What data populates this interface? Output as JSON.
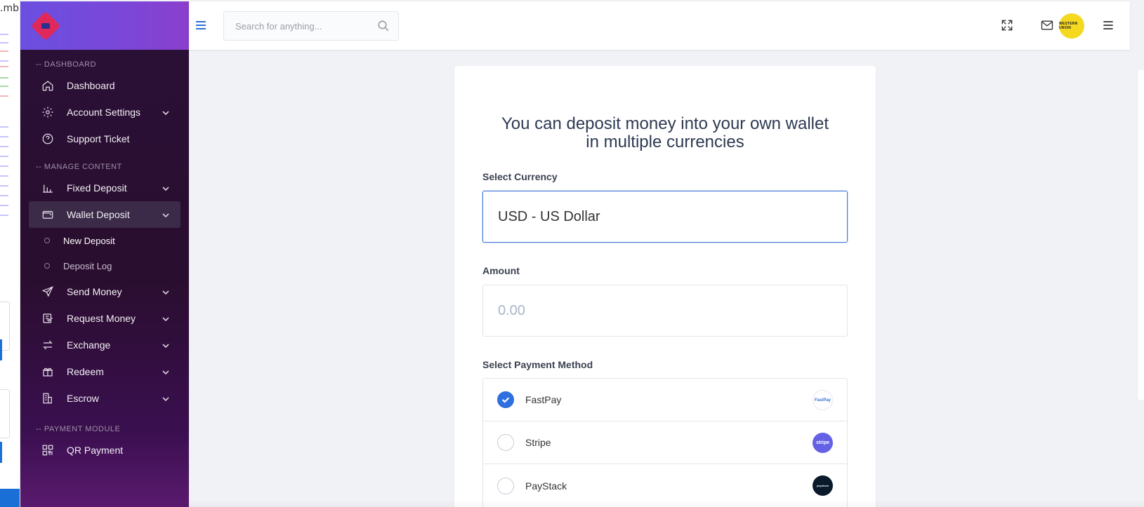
{
  "window": {
    "partial_title": ".mb"
  },
  "colors": {
    "accent": "#2f6fe0",
    "sidebar_bg": "#2b1038",
    "brand_bar": "#6b4fe0",
    "logo": "#e0285a",
    "avatar": "#f5d820"
  },
  "sidebar": {
    "sections": [
      {
        "label": "-- DASHBOARD"
      },
      {
        "label": "-- MANAGE CONTENT"
      },
      {
        "label": "-- PAYMENT MODULE"
      }
    ],
    "items": {
      "dashboard": {
        "label": "Dashboard",
        "icon": "home-icon"
      },
      "account_settings": {
        "label": "Account Settings",
        "icon": "gear-icon"
      },
      "support_ticket": {
        "label": "Support Ticket",
        "icon": "help-circle-icon"
      },
      "fixed_deposit": {
        "label": "Fixed Deposit",
        "icon": "bar-chart-icon"
      },
      "wallet_deposit": {
        "label": "Wallet Deposit",
        "icon": "wallet-icon"
      },
      "new_deposit": {
        "label": "New Deposit"
      },
      "deposit_log": {
        "label": "Deposit Log"
      },
      "send_money": {
        "label": "Send Money",
        "icon": "send-icon"
      },
      "request_money": {
        "label": "Request Money",
        "icon": "request-money-icon"
      },
      "exchange": {
        "label": "Exchange",
        "icon": "exchange-arrows-icon"
      },
      "redeem": {
        "label": "Redeem",
        "icon": "gift-icon"
      },
      "escrow": {
        "label": "Escrow",
        "icon": "escrow-icon"
      },
      "qr_payment": {
        "label": "QR Payment",
        "icon": "qr-code-icon"
      }
    }
  },
  "header": {
    "search_placeholder": "Search for anything...",
    "icons": [
      "menu-icon",
      "search-icon",
      "fullscreen-icon",
      "mail-icon",
      "avatar",
      "hamburger-icon"
    ]
  },
  "main": {
    "heading": "You can deposit money into your own wallet in multiple currencies",
    "currency_label": "Select Currency",
    "currency_value": "USD - US Dollar",
    "amount_label": "Amount",
    "amount_placeholder": "0.00",
    "payment_label": "Select Payment Method",
    "payment_methods": [
      {
        "name": "FastPay",
        "selected": true,
        "logo_text": "FastPay"
      },
      {
        "name": "Stripe",
        "selected": false,
        "logo_text": "stripe"
      },
      {
        "name": "PayStack",
        "selected": false,
        "logo_text": "paystack"
      }
    ]
  }
}
